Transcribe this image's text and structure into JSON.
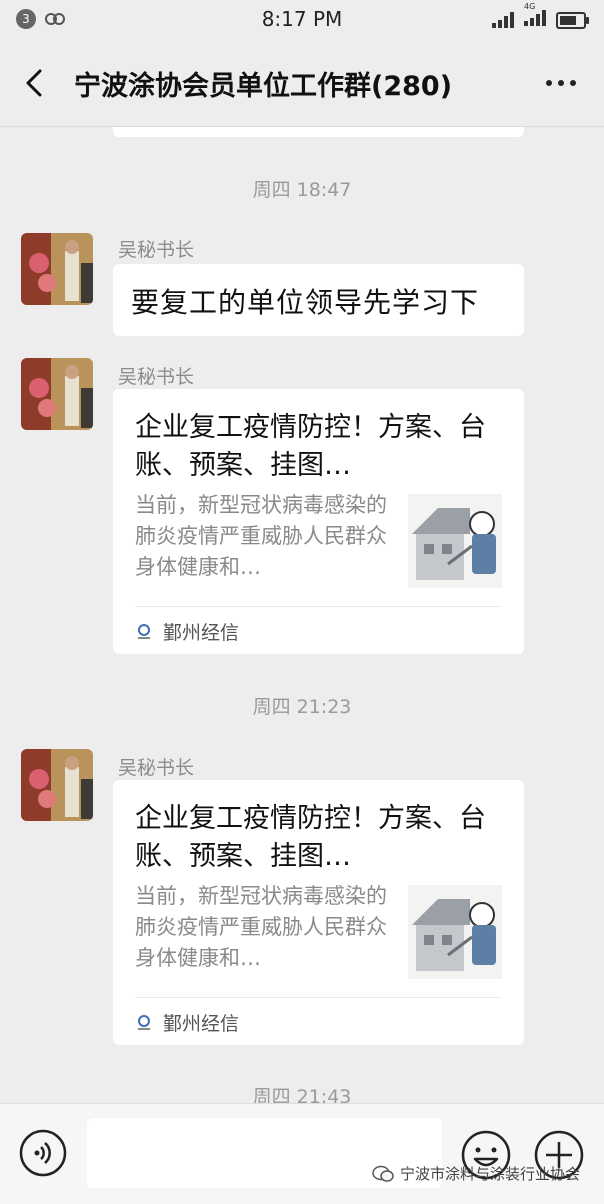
{
  "status_bar": {
    "notification_count": "3",
    "time": "8:17 PM",
    "network": "4G"
  },
  "header": {
    "title": "宁波涂协会员单位工作群(280)"
  },
  "messages": [
    {
      "type": "timestamp",
      "text": "周四 18:47"
    },
    {
      "type": "text",
      "sender": "吴秘书长",
      "text": "要复工的单位领导先学习下"
    },
    {
      "type": "card",
      "sender": "吴秘书长",
      "title": "企业复工疫情防控！方案、台账、预案、挂图…",
      "desc": "当前，新型冠状病毒感染的肺炎疫情严重威胁人民群众身体健康和…",
      "source": "鄞州经信"
    },
    {
      "type": "timestamp",
      "text": "周四 21:23"
    },
    {
      "type": "card",
      "sender": "吴秘书长",
      "title": "企业复工疫情防控！方案、台账、预案、挂图…",
      "desc": "当前，新型冠状病毒感染的肺炎疫情严重威胁人民群众身体健康和…",
      "source": "鄞州经信"
    },
    {
      "type": "timestamp",
      "text": "周四 21:43"
    }
  ],
  "watermark": "宁波市涂料与涂装行业协会",
  "icons": [
    "back-arrow-icon",
    "more-dots-icon",
    "voice-icon",
    "emoji-icon",
    "plus-icon"
  ]
}
